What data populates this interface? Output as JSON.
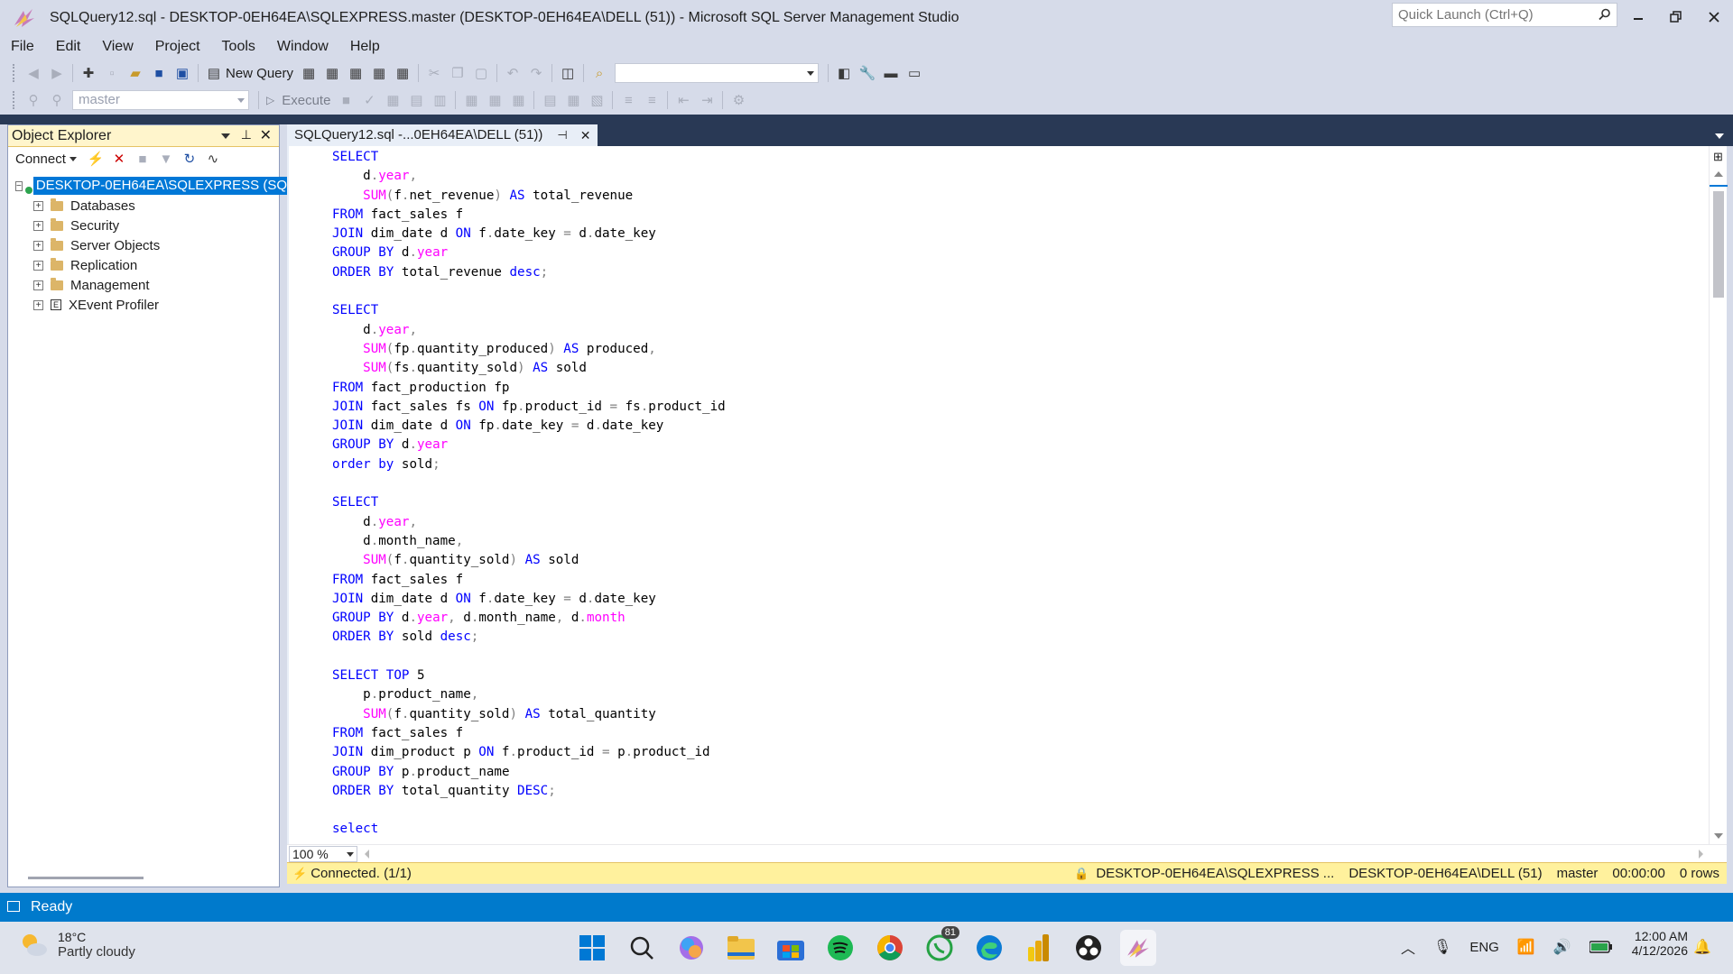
{
  "window": {
    "title": "SQLQuery12.sql - DESKTOP-0EH64EA\\SQLEXPRESS.master (DESKTOP-0EH64EA\\DELL (51)) - Microsoft SQL Server Management Studio",
    "quick_launch_placeholder": "Quick Launch (Ctrl+Q)"
  },
  "menu": [
    "File",
    "Edit",
    "View",
    "Project",
    "Tools",
    "Window",
    "Help"
  ],
  "toolbar": {
    "new_query_label": "New Query",
    "database_combo": "master",
    "execute_label": "Execute"
  },
  "object_explorer": {
    "title": "Object Explorer",
    "connect_label": "Connect",
    "server": "DESKTOP-0EH64EA\\SQLEXPRESS (SQL",
    "nodes": [
      "Databases",
      "Security",
      "Server Objects",
      "Replication",
      "Management",
      "XEvent Profiler"
    ]
  },
  "editor": {
    "tab_label": "SQLQuery12.sql -...0EH64EA\\DELL (51))",
    "zoom": "100 %",
    "code_lines": [
      "SELECT",
      "    d.year,",
      "    SUM(f.net_revenue) AS total_revenue",
      "FROM fact_sales f",
      "JOIN dim_date d ON f.date_key = d.date_key",
      "GROUP BY d.year",
      "ORDER BY total_revenue desc;",
      "",
      "SELECT",
      "    d.year,",
      "    SUM(fp.quantity_produced) AS produced,",
      "    SUM(fs.quantity_sold) AS sold",
      "FROM fact_production fp",
      "JOIN fact_sales fs ON fp.product_id = fs.product_id",
      "JOIN dim_date d ON fp.date_key = d.date_key",
      "GROUP BY d.year",
      "order by sold;",
      "",
      "SELECT",
      "    d.year,",
      "    d.month_name,",
      "    SUM(f.quantity_sold) AS sold",
      "FROM fact_sales f",
      "JOIN dim_date d ON f.date_key = d.date_key",
      "GROUP BY d.year, d.month_name, d.month",
      "ORDER BY sold desc;",
      "",
      "SELECT TOP 5",
      "    p.product_name,",
      "    SUM(f.quantity_sold) AS total_quantity",
      "FROM fact_sales f",
      "JOIN dim_product p ON f.product_id = p.product_id",
      "GROUP BY p.product_name",
      "ORDER BY total_quantity DESC;",
      "",
      "select"
    ]
  },
  "status": {
    "connected": "Connected. (1/1)",
    "server": "DESKTOP-0EH64EA\\SQLEXPRESS ...",
    "user": "DESKTOP-0EH64EA\\DELL (51)",
    "database": "master",
    "elapsed": "00:00:00",
    "rows": "0 rows",
    "ready": "Ready"
  },
  "taskbar": {
    "weather_temp": "18°C",
    "weather_desc": "Partly cloudy",
    "whatsapp_badge": "81",
    "language": "ENG",
    "time": "12:00 AM",
    "date": "4/12/2026"
  },
  "colors": {
    "keyword": "#0000ff",
    "function": "#ff00ff",
    "operator": "#808080",
    "status_bar": "#007acc",
    "connection_bar": "#fff19d"
  }
}
